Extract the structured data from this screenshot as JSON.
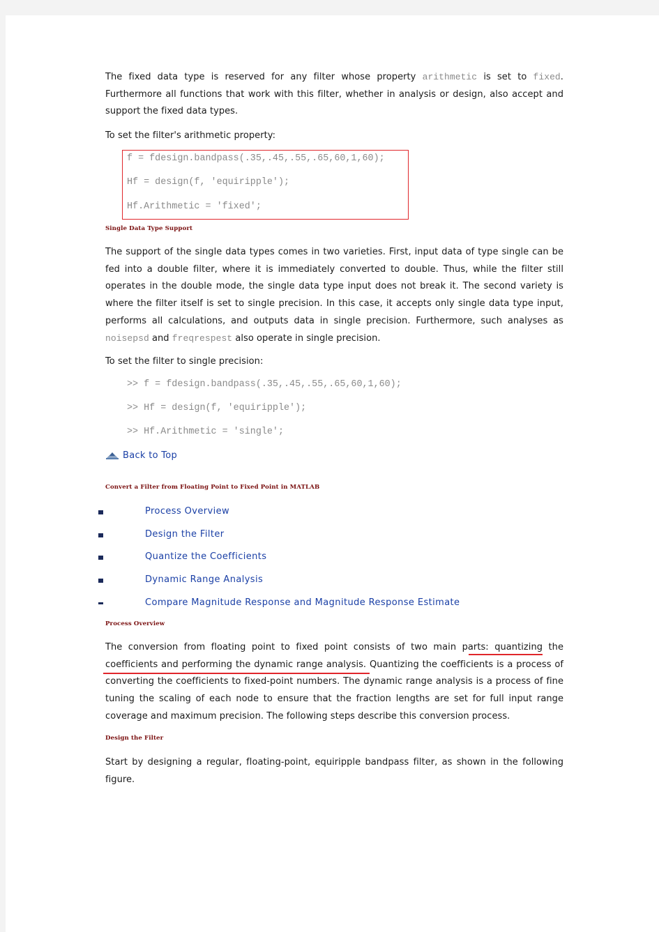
{
  "intro": {
    "line1_pre": "The fixed data type is reserved for any filter whose property ",
    "line1_code1": "arithmetic",
    "line1_mid": " is set to ",
    "line1_code2": "fixed",
    "line1_post": ".",
    "rest": "Furthermore all functions that work with this filter, whether in analysis or design, also accept and support the fixed data types.",
    "set_arith": "To set the filter's arithmetic property:"
  },
  "code_block_1": [
    "f = fdesign.bandpass(.35,.45,.55,.65,60,1,60);",
    "Hf = design(f, 'equiripple');",
    "Hf.Arithmetic = 'fixed';"
  ],
  "single_section": {
    "heading": "Single Data Type Support",
    "para_main": "The support of the single data types comes in two varieties. First, input data of type single can be fed into a double filter, where it is immediately converted to double. Thus, while the filter still operates in the double mode, the single data type input does not break it. The second variety is where the filter itself is set to single precision. In this case, it accepts only single data type input, performs all calculations, and outputs data in single precision. Furthermore, such analyses as",
    "code1": "noisepsd",
    "and": " and ",
    "code2": "freqrespest",
    "para_end": " also operate in single precision.",
    "set_single": "To set the filter to single precision:"
  },
  "code_block_2": [
    ">> f = fdesign.bandpass(.35,.45,.55,.65,60,1,60);",
    ">> Hf = design(f, 'equiripple');",
    ">> Hf.Arithmetic = 'single';"
  ],
  "back_to_top": {
    "label": "Back to Top",
    "icon": "back-to-top-icon"
  },
  "convert_section": {
    "heading": "Convert a Filter from Floating Point to Fixed Point in MATLAB",
    "toc": [
      "Process Overview",
      "Design the Filter",
      "Quantize the Coefficients",
      "Dynamic Range Analysis",
      "Compare Magnitude Response and Magnitude Response Estimate"
    ]
  },
  "process_overview": {
    "heading": "Process Overview",
    "pre": "The conversion from floating point to fixed point consists of two main parts: ",
    "underlined": "quantizing the coefficients and performing the dynamic range analysis.",
    "post": " Quantizing the coefficients is a process of converting the coefficients to fixed-point numbers. The dynamic range analysis is a process of fine tuning the scaling of each node to ensure that the fraction lengths are set for full input range coverage and maximum precision. The following steps describe this conversion process."
  },
  "design_filter": {
    "heading": "Design the Filter",
    "para": "Start by designing a regular, floating-point, equiripple bandpass filter, as shown in the following figure."
  },
  "colors": {
    "heading": "#7a1010",
    "link": "#1b40a6",
    "annotation_red": "#e0262b",
    "code_gray": "#8a8a8a"
  }
}
